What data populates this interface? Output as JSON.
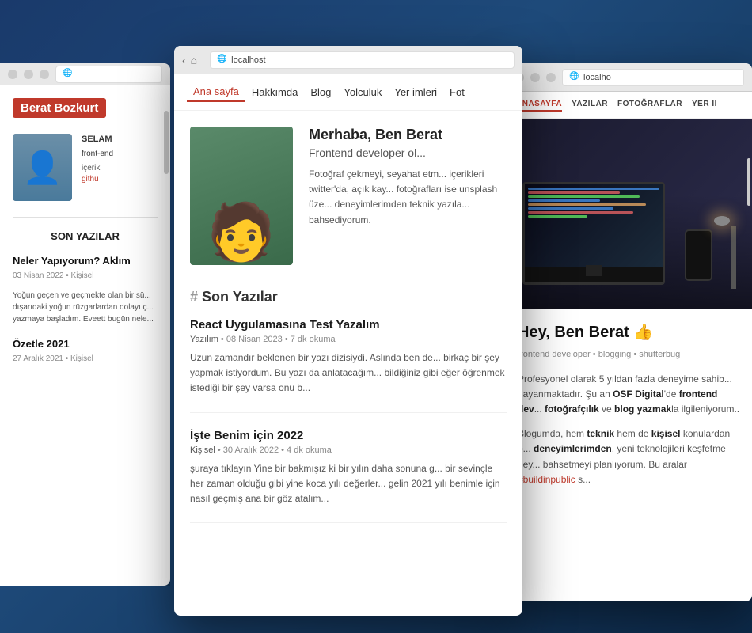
{
  "scene": {
    "background_color": "#1e3a5f"
  },
  "window_left": {
    "url": "",
    "name_badge": "Berat Bozkurt",
    "profile": {
      "greeting": "SELAM",
      "role": "front-end",
      "content_label": "içerik",
      "github_label": "githu"
    },
    "section_title": "SON YAZILAR",
    "posts": [
      {
        "title": "Neler Yapıyorum? Aklım",
        "meta": "03 Nisan 2022 • Kişisel",
        "excerpt": "Yoğun geçen ve geçmekte olan bir sü... dışarıdaki yoğun rüzgarlardan dolayı ç... yazmaya başladım. Eveett bugün nele..."
      },
      {
        "title": "Özetle 2021",
        "meta": "27 Aralık 2021 • Kişisel",
        "excerpt": ""
      }
    ]
  },
  "window_center": {
    "url": "localhost",
    "nav_items": [
      "Ana sayfa",
      "Hakkımda",
      "Blog",
      "Yolculuk",
      "Yer imleri",
      "Fot"
    ],
    "active_nav": "Ana sayfa",
    "hero": {
      "title": "Merhaba, Ben Berat",
      "subtitle": "Frontend developer ol...",
      "description": "Fotoğraf çekmeyi, seyahat etm... içerikleri twitter'da, açık kay... fotoğrafları ise unsplash üze... deneyimlerimden teknik yazıla... bahsediyorum."
    },
    "section_heading": "# Son Yazılar",
    "articles": [
      {
        "title": "React Uygulamasına Test Yazalım",
        "meta": "Yazılım • 08 Nisan 2023 • 7 dk okuma",
        "excerpt": "Uzun zamandır beklenen bir yazı dizisiydi. Aslında ben de... birkaç bir şey yapmak istiyordum. Bu yazı da anlatacağım... bildiğiniz gibi eğer öğrenmek istediği bir şey varsa onu b..."
      },
      {
        "title": "İşte Benim için 2022",
        "meta": "Kişisel • 30 Aralık 2022 • 4 dk okuma",
        "excerpt": "şuraya tıklayın Yine bir bakmışız ki bir yılın daha sonuna g... bir sevinçle her zaman olduğu gibi yine koca yılı değerler... gelin 2021 yılı benimle için nasıl geçmiş ana bir göz atalım..."
      }
    ]
  },
  "window_right": {
    "url": "localho",
    "nav_items": [
      "ANASAYFA",
      "YAZILAR",
      "FOTOĞRAFLAR",
      "YER II"
    ],
    "active_nav": "ANASAYFA",
    "hero_heading": "Hey, Ben Berat 👍",
    "hero_subtitle": "frontend developer • blogging • shutterbug",
    "paragraphs": [
      "Profesyonel olarak 5 yıldan fazla deneyime sahib... dayanmaktadır. Şu an OSF Digital'de frontend dev... fotoğrafçılık ve blog yazmakla ilgileniyorum..",
      "Blogumda, hem teknik hem de kişisel konulardan b... deneyimlerimden, yeni teknolojileri keşfetme hey... bahsetmeyi planlıyorum. Bu aralar #buildinpublic s..."
    ]
  }
}
